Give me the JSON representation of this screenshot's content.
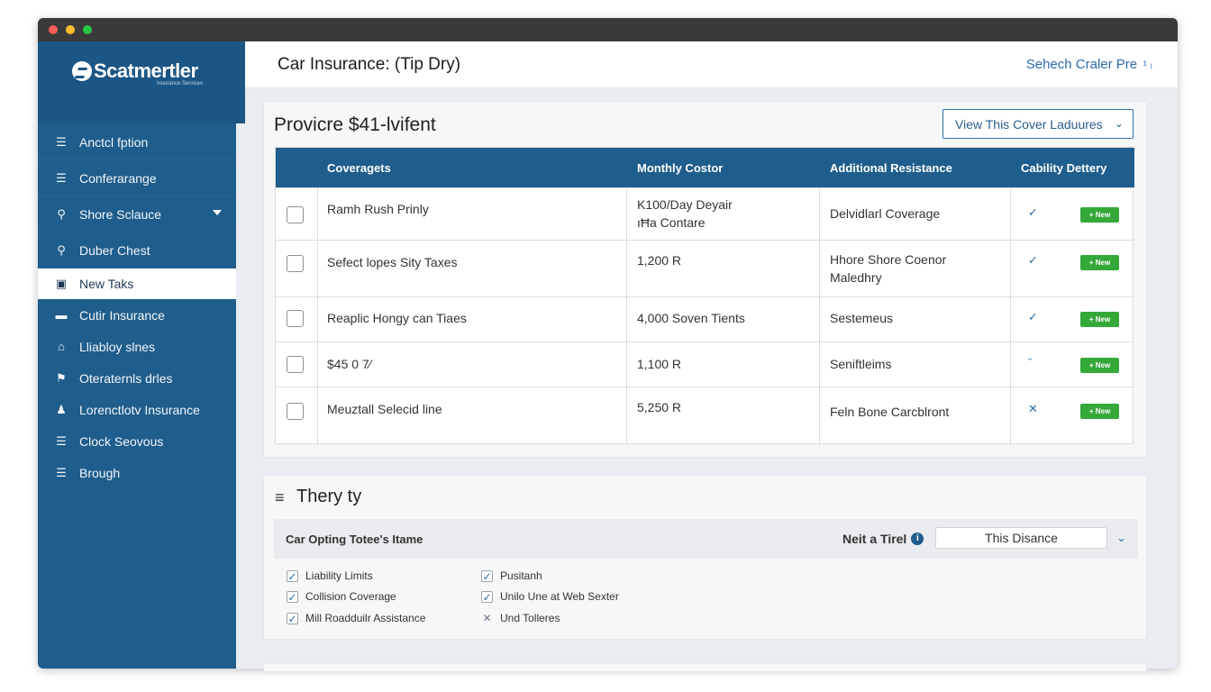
{
  "window": {
    "dots": [
      "#ff5f57",
      "#febc2e",
      "#28c840"
    ]
  },
  "sidebar": {
    "logo": "Scatmertler",
    "logo_sub": "Insurance Services",
    "items": [
      {
        "label": "Anctcl fption",
        "icon": "layers-icon"
      },
      {
        "label": "Conferarange",
        "icon": "layers-icon"
      },
      {
        "label": "Shore Sclauce",
        "icon": "chat-icon"
      },
      {
        "label": "Duber Chest",
        "icon": "search-icon"
      },
      {
        "label": "New Taks",
        "icon": "briefcase-icon"
      },
      {
        "label": "Cutir Insurance",
        "icon": "car-icon"
      },
      {
        "label": "Lliabloy slnes",
        "icon": "home-icon"
      },
      {
        "label": "Oteraternls drles",
        "icon": "flag-icon"
      },
      {
        "label": "Lorenctlotv Insurance",
        "icon": "person-icon"
      },
      {
        "label": "Clock Seovous",
        "icon": "layers-icon"
      },
      {
        "label": "Brough",
        "icon": "layers-icon"
      }
    ]
  },
  "header": {
    "title": "Car Insurance: (Tip Dry)",
    "link": "Sehech Craler Pre",
    "link_suffix": " ¹ ₎"
  },
  "coverage": {
    "title": "Provicre $41-lvifent",
    "select_label": "View This Cover Laduures",
    "columns": [
      "Coveragets",
      "Monthly Costor",
      "Additional Resistance",
      "Cability Dettery"
    ],
    "rows": [
      {
        "name": "Ramh Rush Prinly",
        "cost": "K100/Day Deyair\nıĦa Contare",
        "additional": "Delvidlarl Coverage",
        "mark": "✓",
        "badge": "+ New"
      },
      {
        "name": "Sefect lopes Sity Taxes",
        "cost": "1,200 R",
        "additional": "Hhore Shore Coenor\nMaledhry",
        "mark": "✓",
        "badge": "+ New"
      },
      {
        "name": "Reaplic Hongy can Tiaes",
        "cost": "4,000 Soven Tients",
        "additional": "Sestemeus",
        "mark": "✓",
        "badge": "+ New"
      },
      {
        "name": "$45 0 7⁄",
        "cost": "1,100 R",
        "additional": "Seniftleims",
        "mark": "ˇ",
        "badge": "+ New"
      },
      {
        "name": "Meuztall Selecid line",
        "cost": "5,250 R",
        "additional": "Feln Bone Carcblront",
        "mark": "✕",
        "badge": "+ New"
      }
    ]
  },
  "summary": {
    "title": "Thery ty",
    "filter_label": "Car Opting Totee's Itame",
    "filter_right_label": "Neit a Tirel",
    "filter_value": "This Disance",
    "checks_left": [
      {
        "label": "Liability Limits",
        "mark": "✓"
      },
      {
        "label": "Collision Coverage",
        "mark": "✓"
      },
      {
        "label": "Mill Roadduilr Assistance",
        "mark": "✓"
      }
    ],
    "checks_right": [
      {
        "label": "Pusitanh",
        "mark": "✓"
      },
      {
        "label": "Unilo Une at Web Sexter",
        "mark": "✓"
      },
      {
        "label": "Und Tolleres",
        "mark": "✕"
      }
    ]
  }
}
